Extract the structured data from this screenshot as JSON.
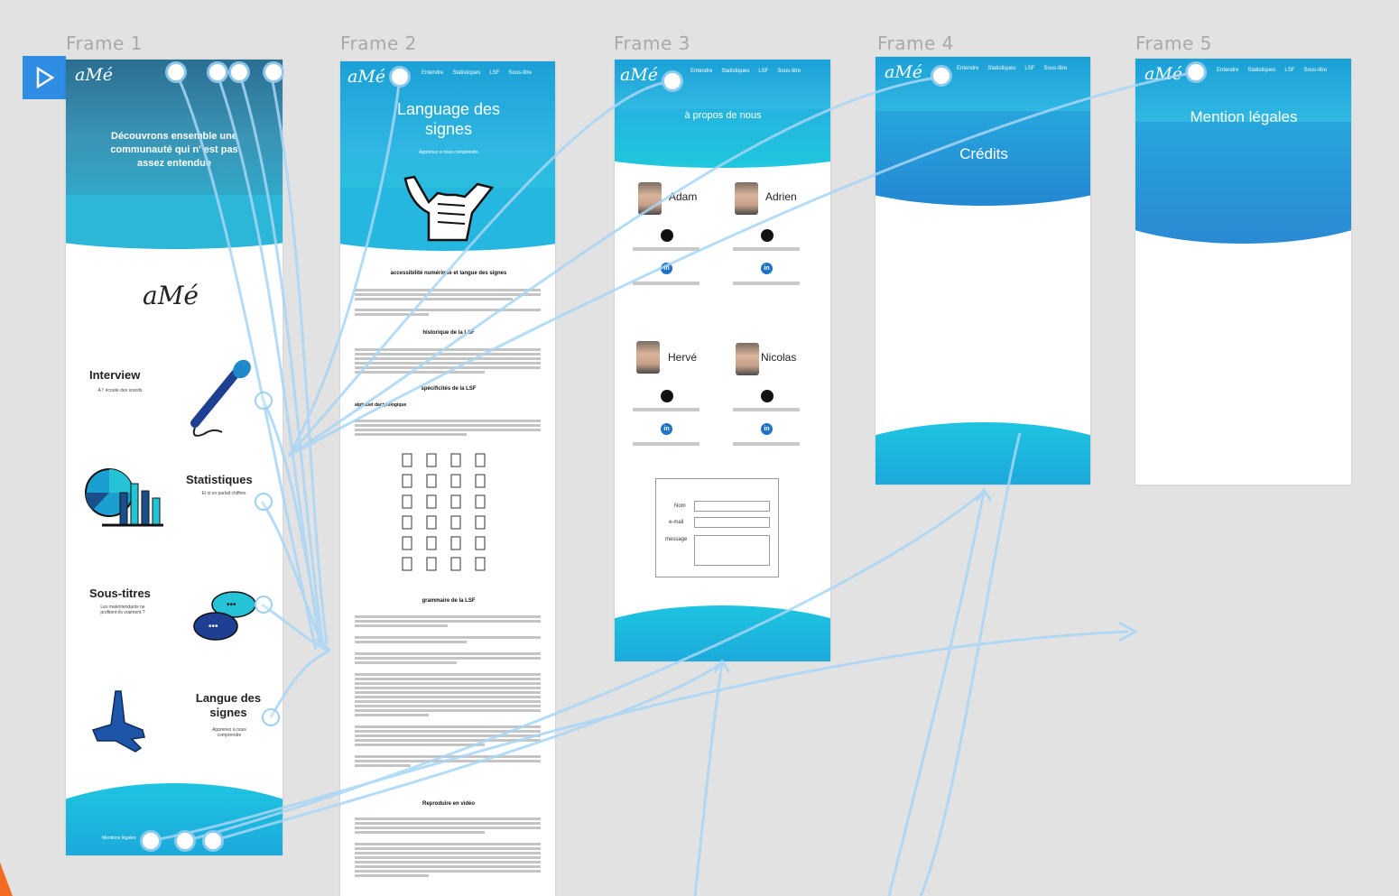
{
  "frames": {
    "f1": {
      "label": "Frame 1"
    },
    "f2": {
      "label": "Frame 2"
    },
    "f3": {
      "label": "Frame 3"
    },
    "f4": {
      "label": "Frame 4"
    },
    "f5": {
      "label": "Frame 5"
    }
  },
  "brand": {
    "logo": "aMé"
  },
  "nav": {
    "items": [
      "Entendre",
      "Statistiques",
      "LSF",
      "Sous-titre"
    ]
  },
  "frame1": {
    "hero": "Découvrons ensemble une communauté qui n' est pas assez entendue",
    "cards": [
      {
        "title": "Interview",
        "sub": "À l' écoute des sourds"
      },
      {
        "title": "Statistiques",
        "sub": "Et si on parlait chiffres"
      },
      {
        "title": "Sous-titres",
        "sub": "Les malentendants ne profitent-ils vraiment ?"
      },
      {
        "title": "Langue des signes",
        "sub": "Apprenez à nous comprendre"
      }
    ],
    "footer_text": "Mentions légales"
  },
  "frame2": {
    "title": "Language des signes",
    "subtitle": "Apprenez à nous comprendre",
    "section1": "accessibilité numérique et langue des signes",
    "section2": "historique de la LSF",
    "section3": "spécificités de la LSF",
    "section3a": "alphabet dactylologique",
    "section4": "grammaire de la LSF",
    "section5": "Reproduire en vidéo"
  },
  "frame3": {
    "title": "à propos de nous",
    "people": [
      "Adam",
      "Adrien",
      "Hervé",
      "Nicolas"
    ],
    "form": {
      "name": "Nom",
      "email": "e-mail",
      "message": "message"
    }
  },
  "frame4": {
    "title": "Crédits"
  },
  "frame5": {
    "title": "Mention légales"
  },
  "colors": {
    "accent": "#2f8de4",
    "header": "#1ba0d6",
    "wire": "#a9d6f5",
    "canvas": "#e2e2e2"
  },
  "icons": [
    "play-icon",
    "microphone-icon",
    "chart-icon",
    "chat-bubbles-icon",
    "hand-sign-icon",
    "github-icon",
    "linkedin-icon"
  ]
}
